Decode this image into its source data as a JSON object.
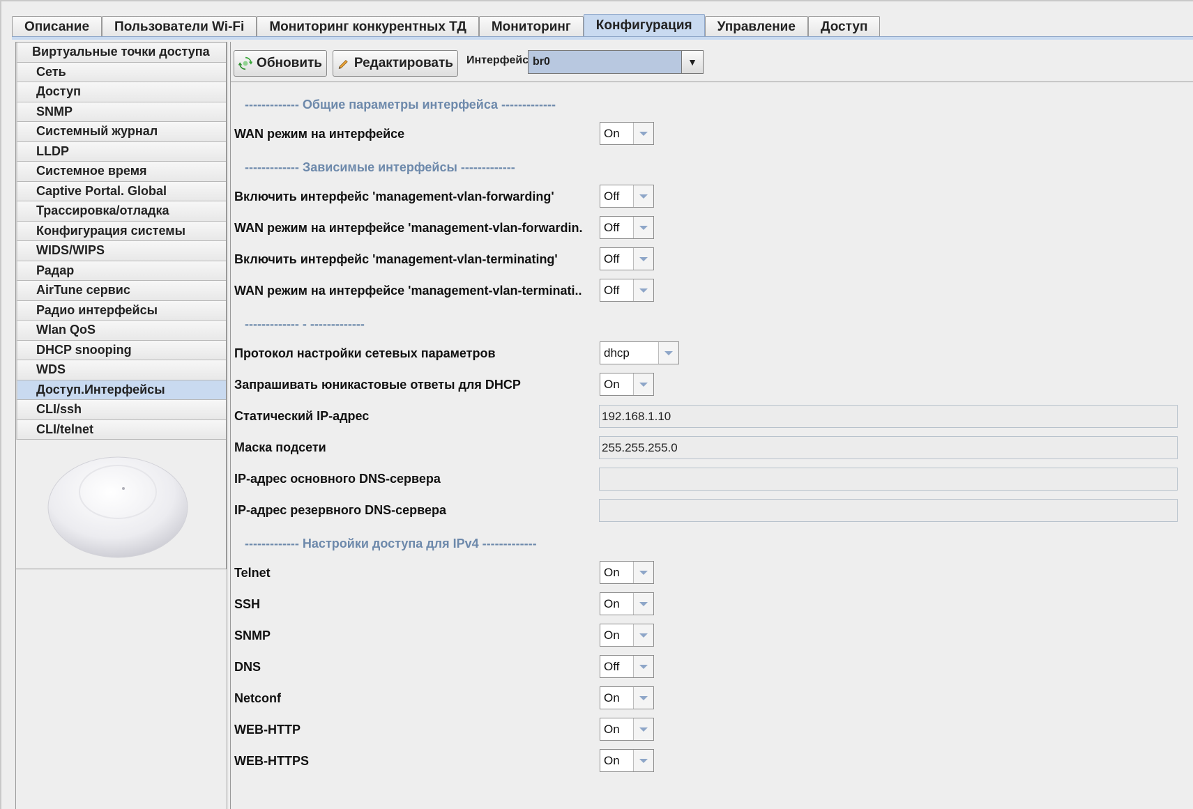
{
  "tabs": [
    {
      "label": "Описание"
    },
    {
      "label": "Пользователи Wi-Fi"
    },
    {
      "label": "Мониторинг конкурентных ТД"
    },
    {
      "label": "Мониторинг"
    },
    {
      "label": "Конфигурация",
      "active": true
    },
    {
      "label": "Управление"
    },
    {
      "label": "Доступ"
    }
  ],
  "sidebar": {
    "items": [
      {
        "label": "Виртуальные точки доступа"
      },
      {
        "label": "Сеть"
      },
      {
        "label": "Доступ"
      },
      {
        "label": "SNMP"
      },
      {
        "label": "Системный журнал"
      },
      {
        "label": "LLDP"
      },
      {
        "label": "Системное время"
      },
      {
        "label": "Captive Portal. Global"
      },
      {
        "label": "Трассировка/отладка"
      },
      {
        "label": "Конфигурация системы"
      },
      {
        "label": "WIDS/WIPS"
      },
      {
        "label": "Радар"
      },
      {
        "label": "AirTune сервис"
      },
      {
        "label": "Радио интерфейсы"
      },
      {
        "label": "Wlan QoS"
      },
      {
        "label": "DHCP snooping"
      },
      {
        "label": "WDS"
      },
      {
        "label": "Доступ.Интерфейсы",
        "active": true
      },
      {
        "label": "CLI/ssh"
      },
      {
        "label": "CLI/telnet"
      }
    ]
  },
  "toolbar": {
    "refresh_label": "Обновить",
    "edit_label": "Редактировать",
    "interface_label": "Интерфейс",
    "interface_value": "br0"
  },
  "sections": {
    "general": "------------- Общие параметры интерфейса -------------",
    "dependent": "------------- Зависимые интерфейсы -------------",
    "blank": "------------- - -------------",
    "ipv4": "------------- Настройки доступа для IPv4 -------------"
  },
  "fields": {
    "wan_mode": {
      "label": "WAN режим на интерфейсе",
      "value": "On"
    },
    "enable_mvf": {
      "label": "Включить интерфейс 'management-vlan-forwarding'",
      "value": "Off"
    },
    "wan_mvf": {
      "label": "WAN режим на интерфейсе 'management-vlan-forwardin.",
      "value": "Off"
    },
    "enable_mvt": {
      "label": "Включить интерфейс 'management-vlan-terminating'",
      "value": "Off"
    },
    "wan_mvt": {
      "label": "WAN режим на интерфейсе 'management-vlan-terminati..",
      "value": "Off"
    },
    "protocol": {
      "label": "Протокол настройки сетевых параметров",
      "value": "dhcp"
    },
    "unicast_dhcp": {
      "label": "Запрашивать юникастовые ответы для DHCP",
      "value": "On"
    },
    "static_ip": {
      "label": "Статический IP-адрес",
      "value": "192.168.1.10"
    },
    "netmask": {
      "label": "Маска подсети",
      "value": "255.255.255.0"
    },
    "dns_primary": {
      "label": "IP-адрес основного DNS-сервера",
      "value": ""
    },
    "dns_secondary": {
      "label": "IP-адрес резервного DNS-сервера",
      "value": ""
    },
    "telnet": {
      "label": "Telnet",
      "value": "On"
    },
    "ssh": {
      "label": "SSH",
      "value": "On"
    },
    "snmp": {
      "label": "SNMP",
      "value": "On"
    },
    "dns": {
      "label": "DNS",
      "value": "Off"
    },
    "netconf": {
      "label": "Netconf",
      "value": "On"
    },
    "web_http": {
      "label": "WEB-HTTP",
      "value": "On"
    },
    "web_https": {
      "label": "WEB-HTTPS",
      "value": "On"
    }
  },
  "colors": {
    "accent": "#c9daf0",
    "section_title": "#6d89ab"
  }
}
